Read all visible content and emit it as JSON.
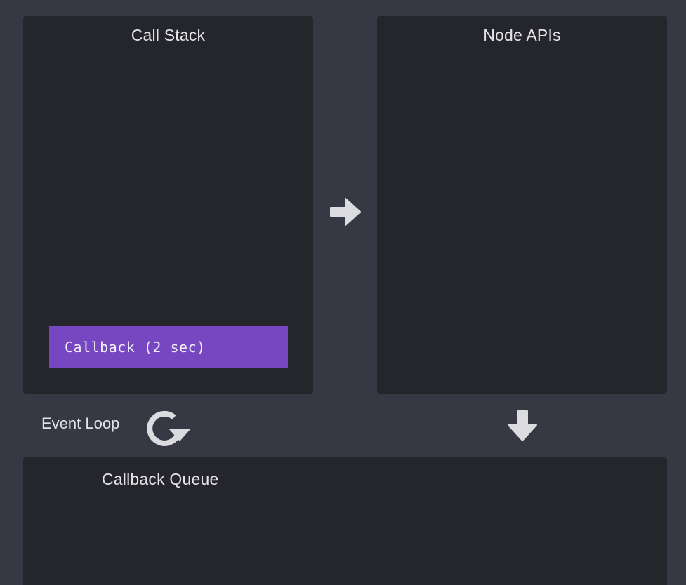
{
  "call_stack": {
    "title": "Call Stack",
    "frames": [
      {
        "label": "Callback (2 sec)"
      }
    ]
  },
  "node_apis": {
    "title": "Node APIs"
  },
  "event_loop": {
    "label": "Event Loop",
    "icon": "refresh-icon"
  },
  "callback_queue": {
    "title": "Callback Queue"
  },
  "icons": {
    "to_node_apis": "arrow-right-icon",
    "to_callback_queue": "arrow-down-icon"
  },
  "colors": {
    "background": "#363844",
    "panel": "#25262b",
    "frame": "#7747c2",
    "arrow": "#dcdce0"
  }
}
